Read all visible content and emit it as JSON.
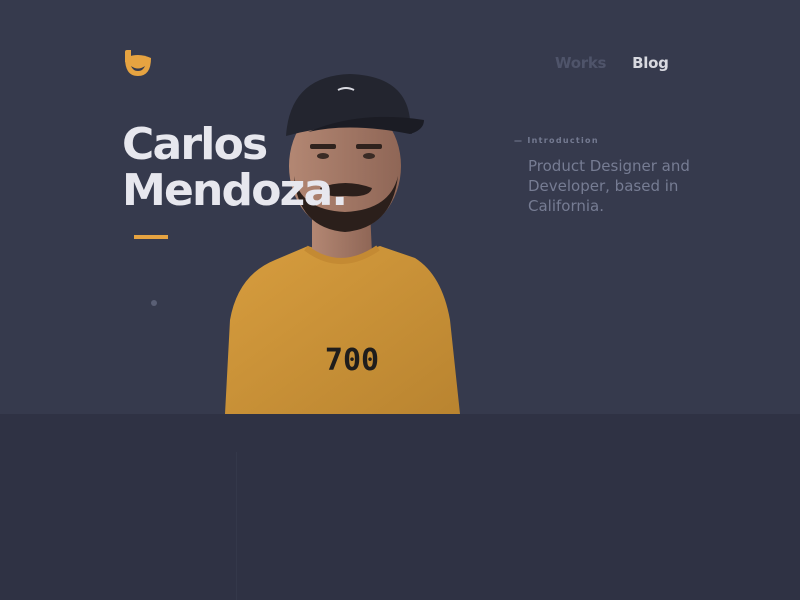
{
  "brand": {
    "logo": "brand-logo-icon",
    "accent_color": "#e6a341"
  },
  "nav": {
    "items": [
      {
        "label": "Works"
      },
      {
        "label": "Blog"
      }
    ]
  },
  "hero": {
    "name_line1": "Carlos",
    "name_line2": "Mendoza.",
    "intro_label": "— Introduction",
    "intro_text": "Product Designer and Developer, based in California.",
    "photo_shirt_text": "700"
  },
  "colors": {
    "background": "#363a4d",
    "lower_band": "#2f3244",
    "heading": "#e7e7ee",
    "muted_text": "#767c93"
  }
}
